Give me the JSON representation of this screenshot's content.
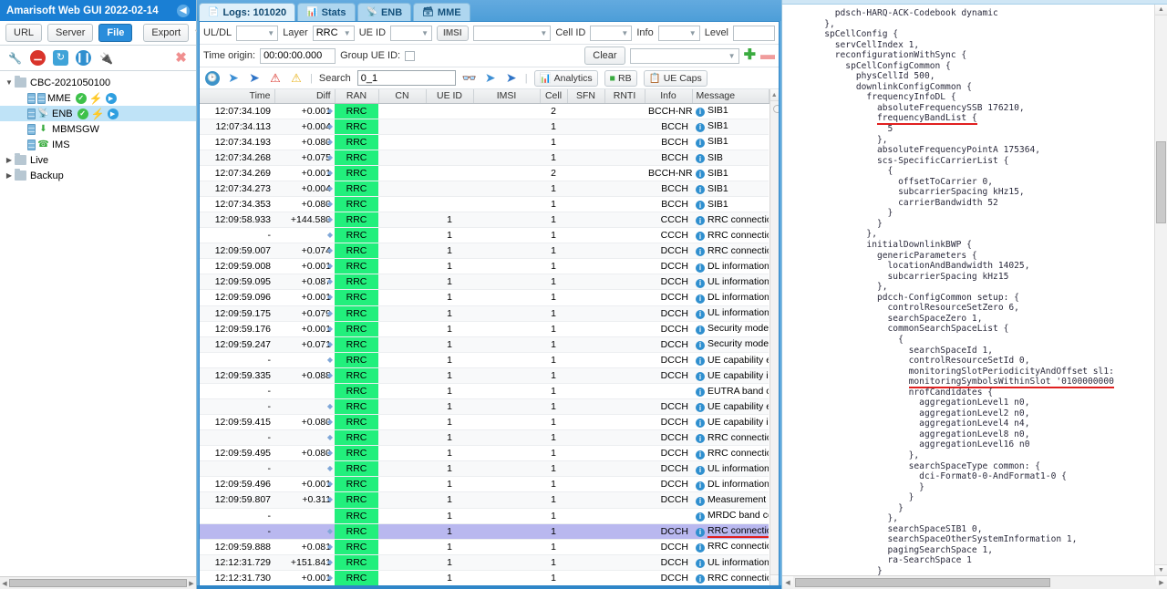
{
  "window": {
    "title": "Amarisoft Web GUI 2022-02-14",
    "collapse_icon": "chevron-left-icon"
  },
  "left": {
    "source_buttons": [
      {
        "label": "URL",
        "active": false
      },
      {
        "label": "Server",
        "active": false
      },
      {
        "label": "File",
        "active": true
      }
    ],
    "export_label": "Export",
    "export_extra_icon": "plug-icon",
    "actions": [
      {
        "icon": "wrench-icon",
        "name": "configure"
      },
      {
        "icon": "stop-icon",
        "name": "stop"
      },
      {
        "icon": "refresh-icon",
        "name": "refresh"
      },
      {
        "icon": "pause-icon",
        "name": "pause"
      },
      {
        "icon": "plug-icon",
        "name": "connect"
      },
      {
        "icon": "close-red-icon",
        "name": "close"
      }
    ],
    "tree": [
      {
        "label": "CBC-2021050100",
        "type": "folder",
        "expanded": true,
        "depth": 0,
        "selected": false
      },
      {
        "label": "MME",
        "type": "service",
        "icon": "server-icon",
        "depth": 1,
        "selected": false,
        "status": [
          "check-green",
          "bolt-green",
          "play-blue"
        ]
      },
      {
        "label": "ENB",
        "type": "service",
        "icon": "antenna-icon",
        "depth": 1,
        "selected": true,
        "status": [
          "check-green",
          "bolt-green",
          "play-blue"
        ]
      },
      {
        "label": "MBMSGW",
        "type": "service",
        "icon": "download-icon",
        "depth": 1,
        "selected": false,
        "status": []
      },
      {
        "label": "IMS",
        "type": "service",
        "icon": "phone-icon",
        "depth": 1,
        "selected": false,
        "status": []
      },
      {
        "label": "Live",
        "type": "folder",
        "expanded": false,
        "depth": 0,
        "selected": false
      },
      {
        "label": "Backup",
        "type": "folder",
        "expanded": false,
        "depth": 0,
        "selected": false
      }
    ]
  },
  "tabs": [
    {
      "label": "Logs: 101020",
      "icon": "document-icon",
      "active": true
    },
    {
      "label": "Stats",
      "icon": "chart-icon",
      "active": false
    },
    {
      "label": "ENB",
      "icon": "antenna-icon",
      "active": false
    },
    {
      "label": "MME",
      "icon": "server-icon",
      "active": false
    }
  ],
  "filters": {
    "uldl_label": "UL/DL",
    "uldl_value": "",
    "layer_label": "Layer",
    "layer_value": "RRC",
    "ueid_label": "UE ID",
    "ueid_value": "",
    "imsi_label": "IMSI",
    "imsi_value": "",
    "cellid_label": "Cell ID",
    "cellid_value": "",
    "info_label": "Info",
    "info_value": "",
    "level_label": "Level",
    "level_value": "",
    "time_origin_label": "Time origin:",
    "time_origin_value": "00:00:00.000",
    "group_ueid_label": "Group UE ID:",
    "group_ueid_checked": false,
    "clear_label": "Clear",
    "preset_value": "",
    "add_icon": "plus-green-icon",
    "remove_icon": "minus-red-icon"
  },
  "toolbar": {
    "icons": [
      {
        "name": "clock-icon"
      },
      {
        "name": "arrow-left-blue-icon"
      },
      {
        "name": "arrow-right-blue-icon"
      },
      {
        "name": "warning-red-icon"
      },
      {
        "name": "warning-yellow-icon"
      }
    ],
    "search_label": "Search",
    "search_value": "0_1",
    "search_placeholder": "",
    "binoculars_icon": "binoculars-icon",
    "prev_icon": "arrow-left-blue-icon",
    "next_icon": "arrow-right-blue-icon",
    "analytics_label": "Analytics",
    "analytics_icon": "chart-icon",
    "rb_label": "RB",
    "rb_icon": "rb-icon",
    "ue_caps_label": "UE Caps",
    "ue_caps_icon": "ue-caps-icon"
  },
  "table": {
    "columns": [
      "Time",
      "Diff",
      "RAN",
      "CN",
      "UE ID",
      "IMSI",
      "Cell",
      "SFN",
      "RNTI",
      "Info",
      "Message"
    ],
    "rows": [
      {
        "time": "12:07:34.109",
        "diff": "+0.001",
        "ran": "RRC",
        "cn": "",
        "ueid": "",
        "imsi": "",
        "cell": "2",
        "sfn": "",
        "rnti": "",
        "info": "BCCH-NR",
        "message": "SIB1",
        "selected": false
      },
      {
        "time": "12:07:34.113",
        "diff": "+0.004",
        "ran": "RRC",
        "cn": "",
        "ueid": "",
        "imsi": "",
        "cell": "1",
        "sfn": "",
        "rnti": "",
        "info": "BCCH",
        "message": "SIB1",
        "selected": false
      },
      {
        "time": "12:07:34.193",
        "diff": "+0.080",
        "ran": "RRC",
        "cn": "",
        "ueid": "",
        "imsi": "",
        "cell": "1",
        "sfn": "",
        "rnti": "",
        "info": "BCCH",
        "message": "SIB1",
        "selected": false
      },
      {
        "time": "12:07:34.268",
        "diff": "+0.075",
        "ran": "RRC",
        "cn": "",
        "ueid": "",
        "imsi": "",
        "cell": "1",
        "sfn": "",
        "rnti": "",
        "info": "BCCH",
        "message": "SIB",
        "selected": false
      },
      {
        "time": "12:07:34.269",
        "diff": "+0.001",
        "ran": "RRC",
        "cn": "",
        "ueid": "",
        "imsi": "",
        "cell": "2",
        "sfn": "",
        "rnti": "",
        "info": "BCCH-NR",
        "message": "SIB1",
        "selected": false
      },
      {
        "time": "12:07:34.273",
        "diff": "+0.004",
        "ran": "RRC",
        "cn": "",
        "ueid": "",
        "imsi": "",
        "cell": "1",
        "sfn": "",
        "rnti": "",
        "info": "BCCH",
        "message": "SIB1",
        "selected": false
      },
      {
        "time": "12:07:34.353",
        "diff": "+0.080",
        "ran": "RRC",
        "cn": "",
        "ueid": "",
        "imsi": "",
        "cell": "1",
        "sfn": "",
        "rnti": "",
        "info": "BCCH",
        "message": "SIB1",
        "selected": false
      },
      {
        "time": "12:09:58.933",
        "diff": "+144.580",
        "ran": "RRC",
        "cn": "",
        "ueid": "1",
        "imsi": "",
        "cell": "1",
        "sfn": "",
        "rnti": "",
        "info": "CCCH",
        "message": "RRC connection request",
        "selected": false
      },
      {
        "time": "-",
        "diff": "",
        "ran": "RRC",
        "cn": "",
        "ueid": "1",
        "imsi": "",
        "cell": "1",
        "sfn": "",
        "rnti": "",
        "info": "CCCH",
        "message": "RRC connection setup",
        "selected": false
      },
      {
        "time": "12:09:59.007",
        "diff": "+0.074",
        "ran": "RRC",
        "cn": "",
        "ueid": "1",
        "imsi": "",
        "cell": "1",
        "sfn": "",
        "rnti": "",
        "info": "DCCH",
        "message": "RRC connection setup complete",
        "selected": false
      },
      {
        "time": "12:09:59.008",
        "diff": "+0.001",
        "ran": "RRC",
        "cn": "",
        "ueid": "1",
        "imsi": "",
        "cell": "1",
        "sfn": "",
        "rnti": "",
        "info": "DCCH",
        "message": "DL information transfer",
        "selected": false
      },
      {
        "time": "12:09:59.095",
        "diff": "+0.087",
        "ran": "RRC",
        "cn": "",
        "ueid": "1",
        "imsi": "",
        "cell": "1",
        "sfn": "",
        "rnti": "",
        "info": "DCCH",
        "message": "UL information transfer",
        "selected": false
      },
      {
        "time": "12:09:59.096",
        "diff": "+0.001",
        "ran": "RRC",
        "cn": "",
        "ueid": "1",
        "imsi": "",
        "cell": "1",
        "sfn": "",
        "rnti": "",
        "info": "DCCH",
        "message": "DL information transfer",
        "selected": false
      },
      {
        "time": "12:09:59.175",
        "diff": "+0.079",
        "ran": "RRC",
        "cn": "",
        "ueid": "1",
        "imsi": "",
        "cell": "1",
        "sfn": "",
        "rnti": "",
        "info": "DCCH",
        "message": "UL information transfer",
        "selected": false
      },
      {
        "time": "12:09:59.176",
        "diff": "+0.001",
        "ran": "RRC",
        "cn": "",
        "ueid": "1",
        "imsi": "",
        "cell": "1",
        "sfn": "",
        "rnti": "",
        "info": "DCCH",
        "message": "Security mode command",
        "selected": false
      },
      {
        "time": "12:09:59.247",
        "diff": "+0.071",
        "ran": "RRC",
        "cn": "",
        "ueid": "1",
        "imsi": "",
        "cell": "1",
        "sfn": "",
        "rnti": "",
        "info": "DCCH",
        "message": "Security mode complete",
        "selected": false
      },
      {
        "time": "-",
        "diff": "",
        "ran": "RRC",
        "cn": "",
        "ueid": "1",
        "imsi": "",
        "cell": "1",
        "sfn": "",
        "rnti": "",
        "info": "DCCH",
        "message": "UE capability enquiry",
        "selected": false
      },
      {
        "time": "12:09:59.335",
        "diff": "+0.088",
        "ran": "RRC",
        "cn": "",
        "ueid": "1",
        "imsi": "",
        "cell": "1",
        "sfn": "",
        "rnti": "",
        "info": "DCCH",
        "message": "UE capability information",
        "selected": false
      },
      {
        "time": "-",
        "diff": "",
        "ran": "RRC",
        "cn": "",
        "ueid": "1",
        "imsi": "",
        "cell": "1",
        "sfn": "",
        "rnti": "",
        "info": "",
        "message": "EUTRA band combinations",
        "selected": false,
        "nodiff": true
      },
      {
        "time": "-",
        "diff": "",
        "ran": "RRC",
        "cn": "",
        "ueid": "1",
        "imsi": "",
        "cell": "1",
        "sfn": "",
        "rnti": "",
        "info": "DCCH",
        "message": "UE capability enquiry",
        "selected": false
      },
      {
        "time": "12:09:59.415",
        "diff": "+0.080",
        "ran": "RRC",
        "cn": "",
        "ueid": "1",
        "imsi": "",
        "cell": "1",
        "sfn": "",
        "rnti": "",
        "info": "DCCH",
        "message": "UE capability information",
        "selected": false
      },
      {
        "time": "-",
        "diff": "",
        "ran": "RRC",
        "cn": "",
        "ueid": "1",
        "imsi": "",
        "cell": "1",
        "sfn": "",
        "rnti": "",
        "info": "DCCH",
        "message": "RRC connection reconfiguration",
        "selected": false
      },
      {
        "time": "12:09:59.495",
        "diff": "+0.080",
        "ran": "RRC",
        "cn": "",
        "ueid": "1",
        "imsi": "",
        "cell": "1",
        "sfn": "",
        "rnti": "",
        "info": "DCCH",
        "message": "RRC connection reconfiguration",
        "selected": false
      },
      {
        "time": "-",
        "diff": "",
        "ran": "RRC",
        "cn": "",
        "ueid": "1",
        "imsi": "",
        "cell": "1",
        "sfn": "",
        "rnti": "",
        "info": "DCCH",
        "message": "UL information transfer",
        "selected": false
      },
      {
        "time": "12:09:59.496",
        "diff": "+0.001",
        "ran": "RRC",
        "cn": "",
        "ueid": "1",
        "imsi": "",
        "cell": "1",
        "sfn": "",
        "rnti": "",
        "info": "DCCH",
        "message": "DL information transfer",
        "selected": false
      },
      {
        "time": "12:09:59.807",
        "diff": "+0.311",
        "ran": "RRC",
        "cn": "",
        "ueid": "1",
        "imsi": "",
        "cell": "1",
        "sfn": "",
        "rnti": "",
        "info": "DCCH",
        "message": "Measurement report",
        "selected": false
      },
      {
        "time": "-",
        "diff": "",
        "ran": "RRC",
        "cn": "",
        "ueid": "1",
        "imsi": "",
        "cell": "1",
        "sfn": "",
        "rnti": "",
        "info": "",
        "message": "MRDC band combinations",
        "selected": false,
        "nodiff": true
      },
      {
        "time": "-",
        "diff": "",
        "ran": "RRC",
        "cn": "",
        "ueid": "1",
        "imsi": "",
        "cell": "1",
        "sfn": "",
        "rnti": "",
        "info": "DCCH",
        "message": "RRC connection reconfiguration",
        "selected": true
      },
      {
        "time": "12:09:59.888",
        "diff": "+0.081",
        "ran": "RRC",
        "cn": "",
        "ueid": "1",
        "imsi": "",
        "cell": "1",
        "sfn": "",
        "rnti": "",
        "info": "DCCH",
        "message": "RRC connection reconfiguration",
        "selected": false
      },
      {
        "time": "12:12:31.729",
        "diff": "+151.841",
        "ran": "RRC",
        "cn": "",
        "ueid": "1",
        "imsi": "",
        "cell": "1",
        "sfn": "",
        "rnti": "",
        "info": "DCCH",
        "message": "UL information transfer",
        "selected": false
      },
      {
        "time": "12:12:31.730",
        "diff": "+0.001",
        "ran": "RRC",
        "cn": "",
        "ueid": "1",
        "imsi": "",
        "cell": "1",
        "sfn": "",
        "rnti": "",
        "info": "DCCH",
        "message": "RRC connection release",
        "selected": false
      }
    ]
  },
  "detail": {
    "lines": [
      "          pdsch-HARQ-ACK-Codebook dynamic",
      "        },",
      "        spCellConfig {",
      "          servCellIndex 1,",
      "          reconfigurationWithSync {",
      "            spCellConfigCommon {",
      "              physCellId 500,",
      "              downlinkConfigCommon {",
      "                frequencyInfoDL {",
      "                  absoluteFrequencySSB 176210,",
      "                  frequencyBandList {",
      "                    5",
      "                  },",
      "                  absoluteFrequencyPointA 175364,",
      "                  scs-SpecificCarrierList {",
      "                    {",
      "                      offsetToCarrier 0,",
      "                      subcarrierSpacing kHz15,",
      "                      carrierBandwidth 52",
      "                    }",
      "                  }",
      "                },",
      "                initialDownlinkBWP {",
      "                  genericParameters {",
      "                    locationAndBandwidth 14025,",
      "                    subcarrierSpacing kHz15",
      "                  },",
      "                  pdcch-ConfigCommon setup: {",
      "                    controlResourceSetZero 6,",
      "                    searchSpaceZero 1,",
      "                    commonSearchSpaceList {",
      "                      {",
      "                        searchSpaceId 1,",
      "                        controlResourceSetId 0,",
      "                        monitoringSlotPeriodicityAndOffset sl1:",
      "                        monitoringSymbolsWithinSlot '0100000000",
      "                        nrofCandidates {",
      "                          aggregationLevel1 n0,",
      "                          aggregationLevel2 n0,",
      "                          aggregationLevel4 n4,",
      "                          aggregationLevel8 n0,",
      "                          aggregationLevel16 n0",
      "                        },",
      "                        searchSpaceType common: {",
      "                          dci-Format0-0-AndFormat1-0 {",
      "                          }",
      "                        }",
      "                      }",
      "                    },",
      "                    searchSpaceSIB1 0,",
      "                    searchSpaceOtherSystemInformation 1,",
      "                    pagingSearchSpace 1,",
      "                    ra-SearchSpace 1",
      "                  }"
    ],
    "underlined_line_indices": [
      10,
      35
    ]
  },
  "colors": {
    "accent_blue": "#1a7fd4",
    "ran_green": "#22ef7c",
    "selection_purple": "#b9b8ef",
    "tree_selection": "#bfe3f7",
    "underline_red": "#e02020"
  }
}
